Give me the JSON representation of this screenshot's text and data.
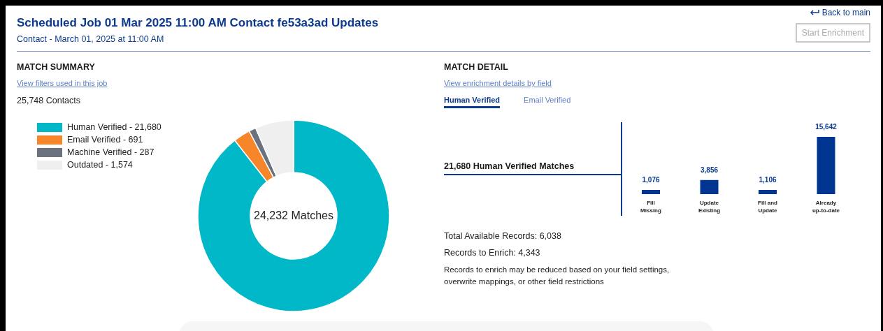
{
  "header": {
    "title": "Scheduled Job 01 Mar 2025 11:00 AM Contact fe53a3ad Updates",
    "subtitle": "Contact - March 01, 2025 at 11:00 AM",
    "back_link": "Back to main",
    "action_button": {
      "label": "Start Enrichment",
      "disabled": true
    }
  },
  "match_summary": {
    "heading": "MATCH SUMMARY",
    "link": "View filters used in this job",
    "count": "25,748 Contacts",
    "center_label": "24,232 Matches",
    "legend": [
      {
        "color": "#00b8c8"
      },
      {
        "color": "#f7862a"
      },
      {
        "color": "#6b727d"
      },
      {
        "color": "#efefef"
      }
    ],
    "chart_data": {
      "type": "donut",
      "categories": [
        "Human Verified - 21,680",
        "Email Verified - 691",
        "Machine Verified - 287",
        "Outdated - 1,574"
      ],
      "values": [
        89.468,
        2.852,
        1.184,
        6.496
      ]
    }
  },
  "match_detail": {
    "heading": "MATCH DETAIL",
    "link": "View enrichment details by field",
    "tabs": [
      {
        "label": "Human Verified",
        "selected": true
      },
      {
        "label": "Email Verified",
        "selected": false
      }
    ],
    "matches_label": "21,680 Human Verified Matches",
    "chart_data": {
      "type": "bar",
      "categories": [
        "Fill Missing",
        "Update Existing",
        "Fill and Update",
        "Already up-to-date"
      ],
      "values": [
        1076,
        3856,
        1106,
        15642
      ],
      "value_labels": [
        "1,076",
        "3,856",
        "1,106",
        "15,642"
      ]
    },
    "total_records": "Total Available Records: 6,038",
    "records_to_enrich": "Records to Enrich: 4,343",
    "note": "Records to enrich may be reduced based on your field settings, overwrite mappings, or other field restrictions"
  }
}
